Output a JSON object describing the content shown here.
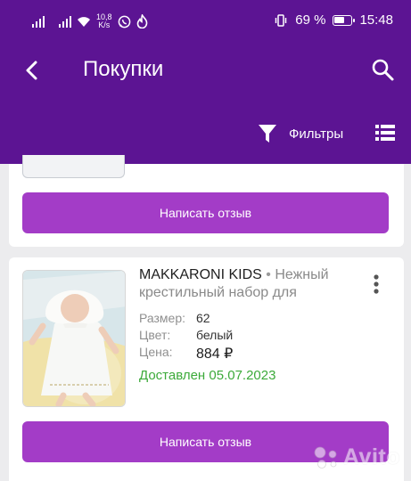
{
  "status_bar": {
    "network_speed": "10,8",
    "network_unit": "K/s",
    "battery_percent": "69 %",
    "battery_level": 0.69,
    "time": "15:48"
  },
  "app_bar": {
    "title": "Покупки",
    "filter_label": "Фильтры",
    "icons": [
      "back-arrow-icon",
      "search-icon",
      "filter-icon",
      "list-view-icon"
    ]
  },
  "orders": [
    {
      "review_button": "Написать отзыв"
    },
    {
      "brand": "MAKKARONI KIDS",
      "separator": " • ",
      "description_line1": "Нежный",
      "description_line2": "крестильный набор для",
      "size_label": "Размер:",
      "size_value": "62",
      "color_label": "Цвет:",
      "color_value": "белый",
      "price_label": "Цена:",
      "price_value": "884 ₽",
      "status": "Доставлен 05.07.2023",
      "review_button": "Написать отзыв"
    }
  ],
  "watermark": "Avito",
  "colors": {
    "header": "#5c1493",
    "button": "#a33cc7",
    "delivered": "#3caa3a",
    "background": "#ececee"
  }
}
